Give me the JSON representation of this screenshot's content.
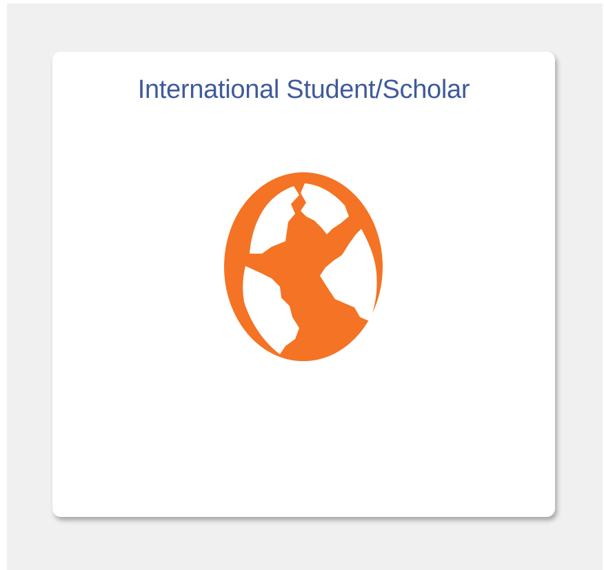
{
  "tile": {
    "title": "International Student/Scholar",
    "icon": "globe-icon"
  },
  "colors": {
    "page_background": "#f0f0f0",
    "tile_background": "#ffffff",
    "title_text": "#3f5a9c",
    "icon_color": "#f47324"
  }
}
